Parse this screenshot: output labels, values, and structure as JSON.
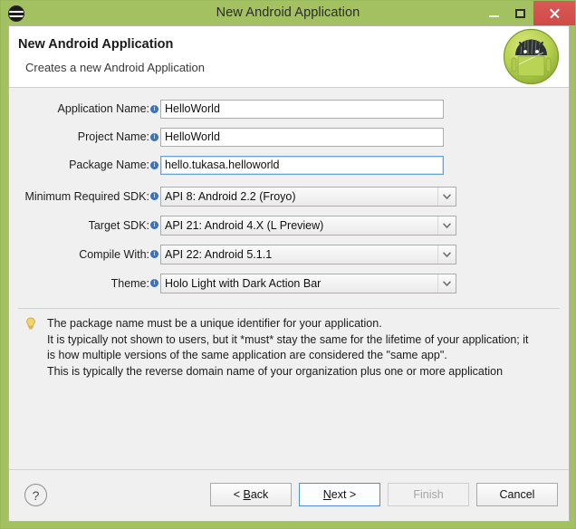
{
  "window": {
    "title": "New Android Application",
    "app_icon": "eclipse-icon",
    "controls": {
      "minimize": "minimize-icon",
      "maximize": "maximize-icon",
      "close": "close-icon"
    },
    "border_color": "#a4c162",
    "titlebar_color": "#a4c162",
    "close_color": "#d0504c"
  },
  "header": {
    "title": "New Android Application",
    "subtitle": "Creates a new Android Application",
    "avatar": "android-robot-icon"
  },
  "form": {
    "text_fields": [
      {
        "label": "Application Name:",
        "value": "HelloWorld",
        "placeholder": "",
        "info_icon": "info-icon",
        "focused": false,
        "name": "application-name"
      },
      {
        "label": "Project Name:",
        "value": "HelloWorld",
        "placeholder": "",
        "info_icon": "info-icon",
        "focused": false,
        "name": "project-name"
      },
      {
        "label": "Package Name:",
        "value": "hello.tukasa.helloworld",
        "placeholder": "",
        "info_icon": "info-icon",
        "focused": true,
        "name": "package-name"
      }
    ],
    "combos": [
      {
        "label": "Minimum Required SDK:",
        "value": "API 8: Android 2.2 (Froyo)",
        "info_icon": "info-icon",
        "name": "minimum-required-sdk"
      },
      {
        "label": "Target SDK:",
        "value": "API 21: Android 4.X (L Preview)",
        "info_icon": "info-icon",
        "name": "target-sdk"
      },
      {
        "label": "Compile With:",
        "value": "API 22: Android 5.1.1",
        "info_icon": "info-icon",
        "name": "compile-with"
      },
      {
        "label": "Theme:",
        "value": "Holo Light with Dark Action Bar",
        "info_icon": "info-icon",
        "name": "theme"
      }
    ]
  },
  "hint": {
    "icon": "lightbulb-icon",
    "lines": [
      "The package name must be a unique identifier for your application.",
      "It is typically not shown to users, but it *must* stay the same for the lifetime of your application; it",
      "is how multiple versions of the same application are considered the \"same app\".",
      "This is typically the reverse domain name of your organization plus one or more application"
    ]
  },
  "footer": {
    "help_label": "?",
    "buttons": [
      {
        "label": "< Back",
        "accel": "B",
        "state": "normal",
        "name": "back-button"
      },
      {
        "label": "Next >",
        "accel": "N",
        "state": "focused",
        "name": "next-button"
      },
      {
        "label": "Finish",
        "accel": "",
        "state": "disabled",
        "name": "finish-button"
      },
      {
        "label": "Cancel",
        "accel": "",
        "state": "normal",
        "name": "cancel-button"
      }
    ]
  }
}
